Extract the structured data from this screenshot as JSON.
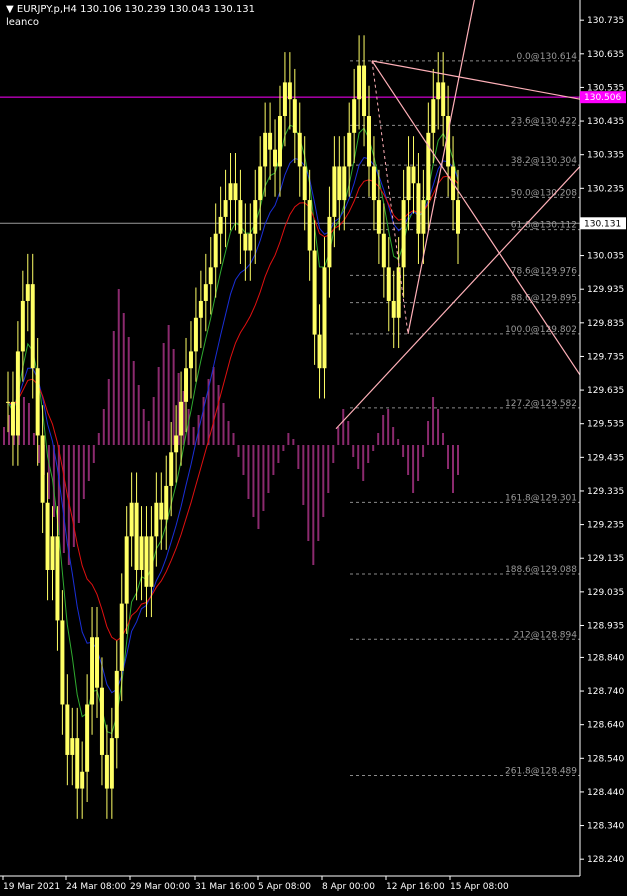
{
  "header": {
    "symbol_line": "EURJPY.p,H4  130.106 130.239 130.043 130.131",
    "indicator_name": "leanco"
  },
  "colors": {
    "background": "#000000",
    "axis": "#ffffff",
    "candle": "#ffff66",
    "histogram": "#8b2a6e",
    "ma_fast": "#2faa2f",
    "ma_mid": "#1a2fd8",
    "ma_slow": "#e01010",
    "fib_lines": "#8a8a8a",
    "trend_lines": "#ffb0b8",
    "magenta_level": "#ff00ff",
    "price_line": "#9a9a9a"
  },
  "chart_data": {
    "type": "candlestick",
    "symbol": "EURJPY.p",
    "timeframe": "H4",
    "ohlc_last": {
      "open": 130.106,
      "high": 130.239,
      "low": 130.043,
      "close": 130.131
    },
    "ylim": [
      128.19,
      130.795
    ],
    "y_ticks": [
      "130.735",
      "130.635",
      "130.535",
      "130.435",
      "130.335",
      "130.235",
      "130.135",
      "130.035",
      "129.935",
      "129.835",
      "129.735",
      "129.635",
      "129.535",
      "129.435",
      "129.335",
      "129.235",
      "129.135",
      "129.035",
      "128.935",
      "128.840",
      "128.740",
      "128.640",
      "128.540",
      "128.440",
      "128.340",
      "128.240"
    ],
    "x_ticks": [
      "19 Mar 2021",
      "24 Mar 08:00",
      "29 Mar 00:00",
      "31 Mar 16:00",
      "5 Apr 08:00",
      "8 Apr 00:00",
      "12 Apr 16:00",
      "15 Apr 08:00"
    ],
    "current_price": "130.131",
    "magenta_level": "130.506",
    "closes": [
      129.6,
      129.5,
      129.75,
      129.9,
      129.95,
      129.7,
      129.5,
      129.3,
      129.1,
      129.2,
      128.95,
      128.7,
      128.55,
      128.6,
      128.45,
      128.5,
      128.7,
      128.9,
      128.75,
      128.55,
      128.45,
      128.6,
      128.8,
      129.0,
      129.2,
      129.3,
      129.1,
      129.2,
      129.05,
      129.2,
      129.3,
      129.25,
      129.35,
      129.45,
      129.5,
      129.6,
      129.7,
      129.75,
      129.85,
      129.9,
      129.95,
      130.0,
      130.1,
      130.15,
      130.2,
      130.25,
      130.2,
      130.1,
      130.05,
      130.1,
      130.2,
      130.3,
      130.4,
      130.35,
      130.3,
      130.45,
      130.55,
      130.5,
      130.4,
      130.3,
      130.2,
      130.05,
      129.8,
      129.7,
      130.0,
      130.15,
      130.3,
      130.2,
      130.3,
      130.4,
      130.5,
      130.6,
      130.45,
      130.3,
      130.2,
      130.1,
      130.0,
      129.9,
      129.85,
      130.0,
      130.2,
      130.3,
      130.25,
      130.1,
      130.2,
      130.4,
      130.5,
      130.55,
      130.45,
      130.3,
      130.2,
      130.1
    ],
    "fib_levels": [
      {
        "label": "0.0@130.614",
        "value": 130.614
      },
      {
        "label": "23.6@130.422",
        "value": 130.422
      },
      {
        "label": "38.2@130.304",
        "value": 130.304
      },
      {
        "label": "50.0@130.208",
        "value": 130.208
      },
      {
        "label": "61.8@130.112",
        "value": 130.112
      },
      {
        "label": "78.6@129.976",
        "value": 129.976
      },
      {
        "label": "88.6@129.895",
        "value": 129.895
      },
      {
        "label": "100.0@129.802",
        "value": 129.802
      },
      {
        "label": "127.2@129.582",
        "value": 129.582
      },
      {
        "label": "161.8@129.301",
        "value": 129.301
      },
      {
        "label": "188.6@129.088",
        "value": 129.088
      },
      {
        "label": "212@128.894",
        "value": 128.894
      },
      {
        "label": "261.8@128.489",
        "value": 128.489
      }
    ],
    "histogram": [
      0.3,
      0.5,
      0.4,
      0.6,
      0.8,
      0.7,
      0.2,
      -0.3,
      -0.5,
      -0.9,
      -1.2,
      -1.5,
      -1.8,
      -2.0,
      -1.7,
      -1.3,
      -0.9,
      -0.6,
      -0.3,
      0.2,
      0.6,
      1.1,
      1.9,
      2.6,
      2.2,
      1.8,
      1.4,
      1.0,
      0.6,
      0.4,
      0.8,
      1.3,
      1.7,
      2.0,
      1.6,
      1.2,
      0.9,
      0.6,
      0.3,
      0.5,
      0.8,
      1.1,
      1.3,
      1.0,
      0.7,
      0.4,
      0.2,
      -0.2,
      -0.5,
      -0.9,
      -1.2,
      -1.4,
      -1.1,
      -0.8,
      -0.5,
      -0.3,
      -0.1,
      0.2,
      0.1,
      -0.4,
      -1.0,
      -1.6,
      -2.0,
      -1.6,
      -1.2,
      -0.8,
      -0.3,
      0.3,
      0.6,
      0.4,
      -0.2,
      -0.4,
      -0.6,
      -0.3,
      -0.1,
      0.2,
      0.5,
      0.6,
      0.3,
      0.1,
      -0.2,
      -0.5,
      -0.8,
      -0.6,
      -0.2,
      0.4,
      0.8,
      0.6,
      0.2,
      -0.4,
      -0.8,
      -0.5
    ]
  }
}
